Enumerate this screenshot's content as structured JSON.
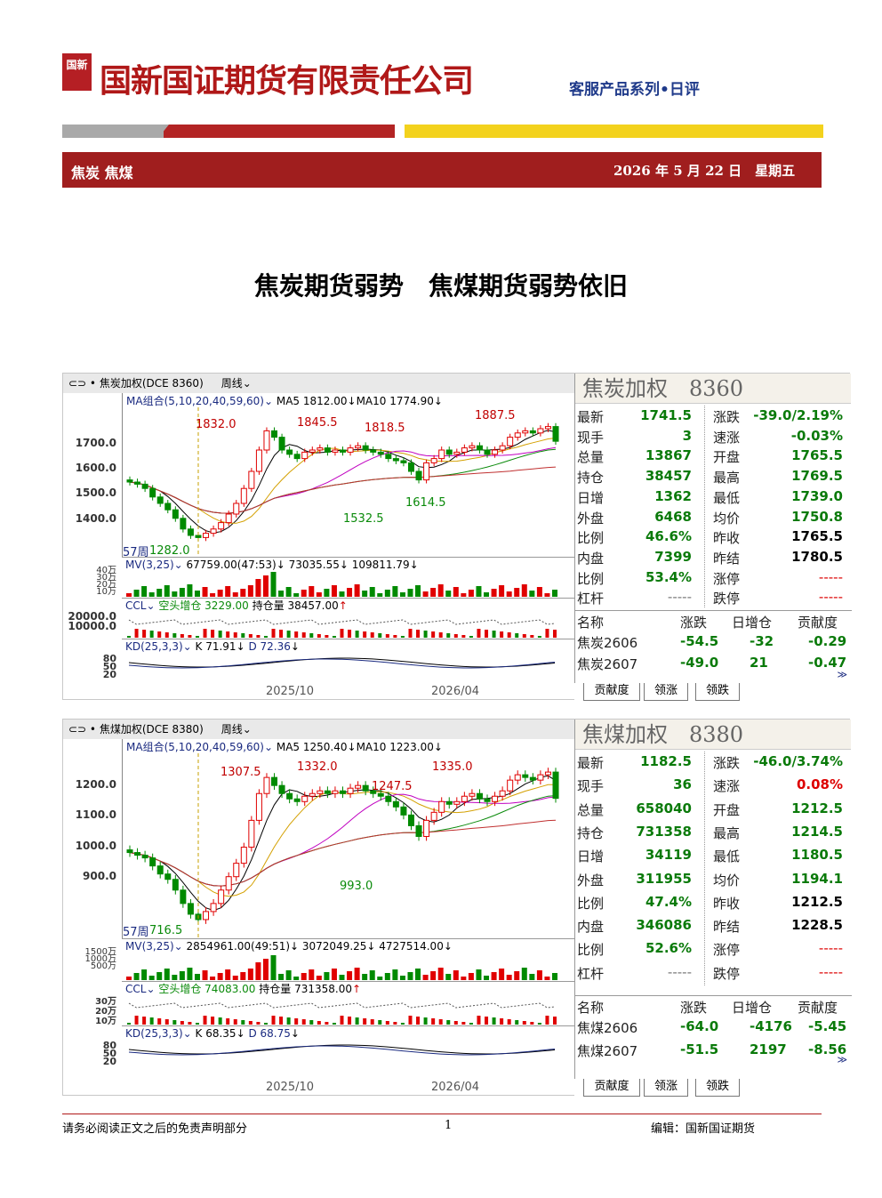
{
  "header": {
    "logo_char": "国新",
    "company": "国新国证期货有限责任公司",
    "series": "客服产品系列•日评",
    "topic": "焦炭 焦煤",
    "date": "2026 年 5 月 22 日　星期五"
  },
  "title": "焦炭期货弱势　焦煤期货弱势依旧",
  "footer": {
    "disclaimer": "请务必阅读正文之后的免责声明部分",
    "page": "1",
    "editor": "编辑：国新国证期货"
  },
  "panels": [
    {
      "toolbar": {
        "name": "焦炭加权(DCE 8360)",
        "period": "周线"
      },
      "ma_line": {
        "label": "MA组合(5,10,20,40,59,60)",
        "ma5": "MA5 1812.00",
        "ma10": "MA10 1774.90"
      },
      "y_labels": [
        "1700.0",
        "1600.0",
        "1500.0",
        "1400.0"
      ],
      "annotations": {
        "p1": "1832.0",
        "p2": "1845.5",
        "p3": "1818.5",
        "p4": "1887.5",
        "p5": "1614.5",
        "p6": "1532.5",
        "p7": "1282.0",
        "weeks": "57周"
      },
      "mv": {
        "label": "MV(3,25)",
        "v1": "67759.00(47:53)",
        "v2": "73035.55",
        "v3": "109811.79",
        "y": [
          "40万",
          "30万",
          "20万",
          "10万"
        ]
      },
      "ccl": {
        "label": "CCL",
        "kind": "空头增仓",
        "v1": "3229.00",
        "hold_label": "持仓量",
        "hold": "38457.00",
        "y": [
          "20000.0",
          "10000.0"
        ]
      },
      "kd": {
        "label": "KD(25,3,3)",
        "k": "K 71.91",
        "d": "D 72.36",
        "y": [
          "80",
          "50",
          "20"
        ]
      },
      "x_labels": [
        "2025/10",
        "2026/04"
      ],
      "info_title": "焦炭加权　8360",
      "quotes": [
        [
          "最新",
          "1741.5",
          "涨跌",
          "-39.0/2.19%"
        ],
        [
          "现手",
          "3",
          "速涨",
          "-0.03%"
        ],
        [
          "总量",
          "13867",
          "开盘",
          "1765.5"
        ],
        [
          "持仓",
          "38457",
          "最高",
          "1769.5"
        ],
        [
          "日增",
          "1362",
          "最低",
          "1739.0"
        ],
        [
          "外盘",
          "6468",
          "均价",
          "1750.8"
        ],
        [
          "比例",
          "46.6%",
          "昨收",
          "1765.5"
        ],
        [
          "内盘",
          "7399",
          "昨结",
          "1780.5"
        ],
        [
          "比例",
          "53.4%",
          "涨停",
          "-----"
        ],
        [
          "杠杆",
          "-----",
          "跌停",
          "-----"
        ]
      ],
      "holdings_head": [
        "名称",
        "涨跌",
        "日增仓",
        "贡献度"
      ],
      "holdings": [
        [
          "焦炭2606",
          "-54.5",
          "-32",
          "-0.29"
        ],
        [
          "焦炭2607",
          "-49.0",
          "21",
          "-0.47"
        ]
      ],
      "tabs": [
        "贡献度",
        "领涨",
        "领跌"
      ],
      "chart_data": {
        "type": "candlestick",
        "x_ticks": [
          "2025/10",
          "2026/04"
        ],
        "ylim": [
          1250,
          1900
        ],
        "closes": [
          1550,
          1540,
          1520,
          1480,
          1450,
          1420,
          1380,
          1330,
          1300,
          1290,
          1310,
          1330,
          1360,
          1400,
          1450,
          1520,
          1600,
          1700,
          1790,
          1760,
          1700,
          1680,
          1660,
          1690,
          1700,
          1710,
          1690,
          1700,
          1690,
          1710,
          1720,
          1700,
          1690,
          1680,
          1660,
          1650,
          1640,
          1600,
          1560,
          1640,
          1660,
          1700,
          1680,
          1690,
          1710,
          1720,
          1700,
          1680,
          1700,
          1720,
          1760,
          1780,
          1790,
          1780,
          1800,
          1810,
          1741
        ]
      }
    },
    {
      "toolbar": {
        "name": "焦煤加权(DCE 8380)",
        "period": "周线"
      },
      "ma_line": {
        "label": "MA组合(5,10,20,40,59,60)",
        "ma5": "MA5 1250.40",
        "ma10": "MA10 1223.00"
      },
      "y_labels": [
        "1200.0",
        "1100.0",
        "1000.0",
        "900.0"
      ],
      "annotations": {
        "p1": "1307.5",
        "p2": "1332.0",
        "p3": "1247.5",
        "p4": "1335.0",
        "p5": "993.0",
        "p7": "716.5",
        "weeks": "57周"
      },
      "mv": {
        "label": "MV(3,25)",
        "v1": "2854961.00(49:51)",
        "v2": "3072049.25",
        "v3": "4727514.00",
        "y": [
          "1500万",
          "1000万",
          "500万"
        ]
      },
      "ccl": {
        "label": "CCL",
        "kind": "空头增仓",
        "v1": "74083.00",
        "hold_label": "持仓量",
        "hold": "731358.00",
        "y": [
          "30万",
          "20万",
          "10万"
        ]
      },
      "kd": {
        "label": "KD(25,3,3)",
        "k": "K 68.35",
        "d": "D 68.75",
        "y": [
          "80",
          "50",
          "20"
        ]
      },
      "x_labels": [
        "2025/10",
        "2026/04"
      ],
      "info_title": "焦煤加权　8380",
      "quotes": [
        [
          "最新",
          "1182.5",
          "涨跌",
          "-46.0/3.74%"
        ],
        [
          "现手",
          "36",
          "速涨",
          "0.08%"
        ],
        [
          "总量",
          "658040",
          "开盘",
          "1212.5"
        ],
        [
          "持仓",
          "731358",
          "最高",
          "1214.5"
        ],
        [
          "日增",
          "34119",
          "最低",
          "1180.5"
        ],
        [
          "外盘",
          "311955",
          "均价",
          "1194.1"
        ],
        [
          "比例",
          "47.4%",
          "昨收",
          "1212.5"
        ],
        [
          "内盘",
          "346086",
          "昨结",
          "1228.5"
        ],
        [
          "比例",
          "52.6%",
          "涨停",
          "-----"
        ],
        [
          "杠杆",
          "-----",
          "跌停",
          "-----"
        ]
      ],
      "holdings_head": [
        "名称",
        "涨跌",
        "日增仓",
        "贡献度"
      ],
      "holdings": [
        [
          "焦煤2606",
          "-64.0",
          "-4176",
          "-5.45"
        ],
        [
          "焦煤2607",
          "-51.5",
          "2197",
          "-8.56"
        ]
      ],
      "tabs": [
        "贡献度",
        "领涨",
        "领跌"
      ],
      "chart_data": {
        "type": "candlestick",
        "x_ticks": [
          "2025/10",
          "2026/04"
        ],
        "ylim": [
          700,
          1350
        ],
        "closes": [
          980,
          970,
          960,
          930,
          900,
          880,
          840,
          790,
          750,
          730,
          760,
          790,
          840,
          890,
          940,
          1000,
          1100,
          1200,
          1260,
          1230,
          1200,
          1180,
          1170,
          1190,
          1200,
          1210,
          1200,
          1210,
          1200,
          1220,
          1230,
          1210,
          1200,
          1190,
          1170,
          1150,
          1120,
          1080,
          1040,
          1100,
          1130,
          1170,
          1160,
          1170,
          1190,
          1200,
          1180,
          1170,
          1190,
          1210,
          1250,
          1270,
          1260,
          1250,
          1270,
          1280,
          1182
        ]
      }
    }
  ]
}
